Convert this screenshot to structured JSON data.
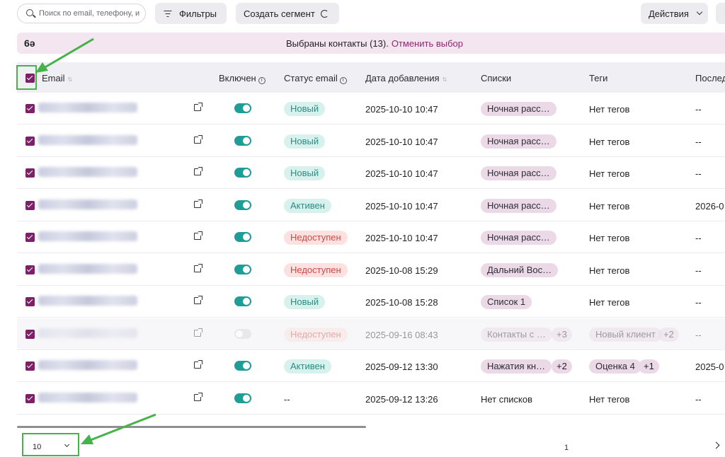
{
  "toolbar": {
    "search_placeholder": "Поиск по email, телефону, и",
    "filters_label": "Фильтры",
    "create_segment_label": "Создать сегмент",
    "actions_label": "Действия"
  },
  "selection_banner": {
    "text": "Выбраны контакты (13).",
    "cancel_label": "Отменить выбор"
  },
  "columns": {
    "email": "Email",
    "enabled": "Включен",
    "email_status": "Статус email",
    "date_added": "Дата добавления",
    "lists": "Списки",
    "tags": "Теги",
    "last": "Послед"
  },
  "rows": [
    {
      "enabled": true,
      "status": "Новый",
      "status_kind": "new",
      "date": "2025-10-10 10:47",
      "list": "Ночная расс…",
      "list_more": "",
      "tag": "Нет тегов",
      "tag_pill": false,
      "tag_more": "",
      "last": "--"
    },
    {
      "enabled": true,
      "status": "Новый",
      "status_kind": "new",
      "date": "2025-10-10 10:47",
      "list": "Ночная расс…",
      "list_more": "",
      "tag": "Нет тегов",
      "tag_pill": false,
      "tag_more": "",
      "last": "--"
    },
    {
      "enabled": true,
      "status": "Новый",
      "status_kind": "new",
      "date": "2025-10-10 10:47",
      "list": "Ночная расс…",
      "list_more": "",
      "tag": "Нет тегов",
      "tag_pill": false,
      "tag_more": "",
      "last": "--"
    },
    {
      "enabled": true,
      "status": "Активен",
      "status_kind": "active",
      "date": "2025-10-10 10:47",
      "list": "Ночная расс…",
      "list_more": "",
      "tag": "Нет тегов",
      "tag_pill": false,
      "tag_more": "",
      "last": "2026-0"
    },
    {
      "enabled": true,
      "status": "Недоступен",
      "status_kind": "unavail",
      "date": "2025-10-10 10:47",
      "list": "Ночная расс…",
      "list_more": "",
      "tag": "Нет тегов",
      "tag_pill": false,
      "tag_more": "",
      "last": "--"
    },
    {
      "enabled": true,
      "status": "Недоступен",
      "status_kind": "unavail",
      "date": "2025-10-08 15:29",
      "list": "Дальний Вос…",
      "list_more": "",
      "tag": "Нет тегов",
      "tag_pill": false,
      "tag_more": "",
      "last": "--"
    },
    {
      "enabled": true,
      "status": "Новый",
      "status_kind": "new",
      "date": "2025-10-08 15:28",
      "list": "Список 1",
      "list_more": "",
      "tag": "Нет тегов",
      "tag_pill": false,
      "tag_more": "",
      "last": "--"
    },
    {
      "enabled": false,
      "status": "Недоступен",
      "status_kind": "unavail",
      "date": "2025-09-16 08:43",
      "list": "Контакты с …",
      "list_more": "+3",
      "tag": "Новый клиент",
      "tag_pill": true,
      "tag_more": "+2",
      "last": "--",
      "dim": true
    },
    {
      "enabled": true,
      "status": "Активен",
      "status_kind": "active",
      "date": "2025-09-12 13:30",
      "list": "Нажатия кн…",
      "list_more": "+2",
      "tag": "Оценка 4",
      "tag_pill": true,
      "tag_more": "+1",
      "last": "2025-0"
    },
    {
      "enabled": true,
      "status": "--",
      "status_kind": "none",
      "date": "2025-09-12 13:26",
      "list": "Нет списков",
      "list_plain": true,
      "list_more": "",
      "tag": "Нет тегов",
      "tag_pill": false,
      "tag_more": "",
      "last": "--"
    }
  ],
  "pagination": {
    "page_size": "10",
    "page": "1"
  },
  "colors": {
    "accent": "#7b2167",
    "toggle_on": "#1e9e96",
    "annotation_green": "#45b24a",
    "banner_bg": "#f3e6f0"
  }
}
